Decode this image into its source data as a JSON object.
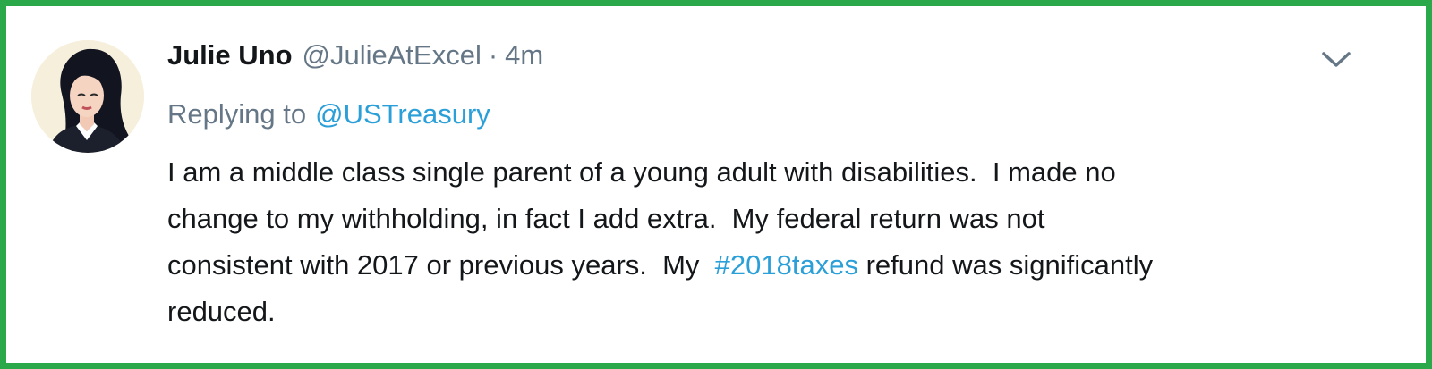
{
  "tweet": {
    "author_name": "Julie Uno",
    "author_handle": "@JulieAtExcel",
    "separator": "·",
    "time": "4m",
    "reply_prefix": "Replying to",
    "reply_to": "@USTreasury",
    "body_line1": "I am a middle class single parent of a young adult with disabilities.  I made no",
    "body_line2": "change to my withholding, in fact I add extra.  My federal return was not",
    "body_line3_before": "consistent with 2017 or previous years.  My  ",
    "hashtag": "#2018taxes",
    "body_line3_after": " refund was significantly",
    "body_line4": "reduced."
  },
  "icons": {
    "menu": "chevron-down-icon",
    "avatar": "avatar"
  },
  "colors": {
    "border": "#2ba84a",
    "link": "#2a9fd8",
    "muted": "#657786",
    "text": "#14171a"
  }
}
